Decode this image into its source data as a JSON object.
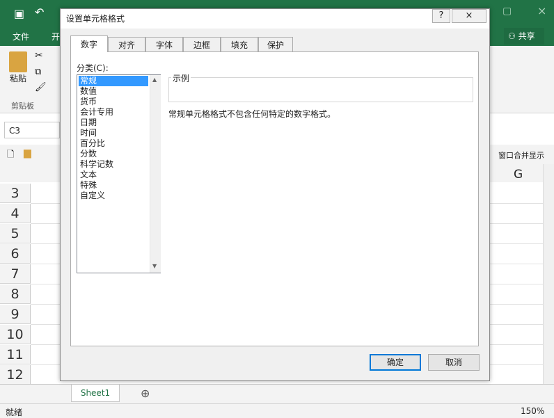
{
  "excel": {
    "ribbon_tab_file": "文件",
    "ribbon_tab_home_partial": "开",
    "share": "共享",
    "paste": "粘贴",
    "clipboard": "剪贴板",
    "namebox": "C3",
    "merge_show": "窗口合并显示",
    "col_g": "G",
    "rows": [
      "3",
      "4",
      "5",
      "6",
      "7",
      "8",
      "9",
      "10",
      "11",
      "12"
    ],
    "sheet_tab": "Sheet1",
    "status": "就绪",
    "zoom": "150%",
    "accent": "#217346"
  },
  "dialog": {
    "title": "设置单元格格式",
    "help": "?",
    "close": "×",
    "tabs": [
      "数字",
      "对齐",
      "字体",
      "边框",
      "填充",
      "保护"
    ],
    "category_label": "分类(C):",
    "categories": [
      "常规",
      "数值",
      "货币",
      "会计专用",
      "日期",
      "时间",
      "百分比",
      "分数",
      "科学记数",
      "文本",
      "特殊",
      "自定义"
    ],
    "selected_category": "常规",
    "sample_label": "示例",
    "description": "常规单元格格式不包含任何特定的数字格式。",
    "ok": "确定",
    "cancel": "取消"
  }
}
